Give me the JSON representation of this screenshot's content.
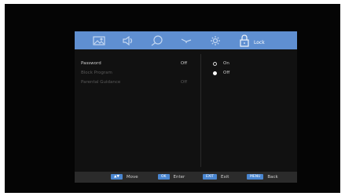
{
  "tabs": [
    {
      "icon": "picture-icon",
      "label": ""
    },
    {
      "icon": "sound-icon",
      "label": ""
    },
    {
      "icon": "search-channel-icon",
      "label": ""
    },
    {
      "icon": "time-icon",
      "label": ""
    },
    {
      "icon": "setup-gear-icon",
      "label": ""
    },
    {
      "icon": "lock-icon",
      "label": "Lock"
    }
  ],
  "lock_label": "Lock",
  "settings": [
    {
      "label": "Password",
      "value": "Off"
    },
    {
      "label": "Block Program",
      "value": ""
    },
    {
      "label": "Parental Guidance",
      "value": "Off"
    }
  ],
  "options": [
    {
      "label": "On",
      "selected": false
    },
    {
      "label": "Off",
      "selected": true
    }
  ],
  "footer": [
    {
      "key": "▲▼",
      "label": "Move"
    },
    {
      "key": "OK",
      "label": "Enter"
    },
    {
      "key": "EXIT",
      "label": "Exit"
    },
    {
      "key": "MENU",
      "label": "Back"
    }
  ],
  "colors": {
    "accent": "#5f8fd1",
    "key": "#4a86d0",
    "panel": "#111111"
  }
}
